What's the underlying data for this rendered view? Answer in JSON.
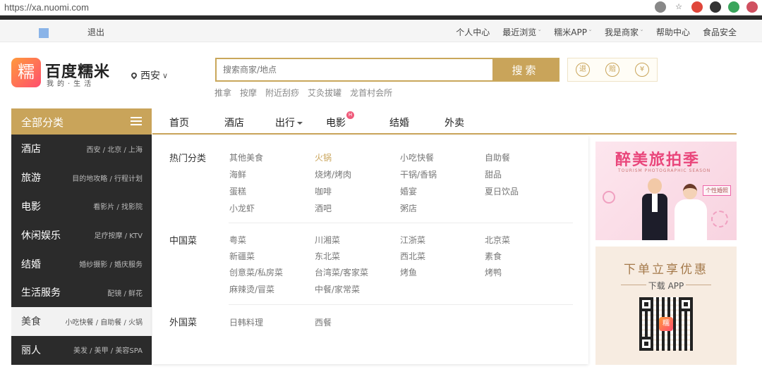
{
  "browser": {
    "url": "https://xa.nuomi.com"
  },
  "topbar": {
    "logout": "退出",
    "links": [
      "个人中心",
      "最近浏览",
      "糯米APP",
      "我是商家",
      "帮助中心",
      "食品安全"
    ]
  },
  "header": {
    "logo_char": "糯",
    "logo_title": "百度糯米",
    "logo_subtitle": "我的·生活",
    "city": "西安",
    "search_placeholder": "搜索商家/地点",
    "search_button": "搜索",
    "hot_words": [
      "推拿",
      "按摩",
      "附近刮痧",
      "艾灸拔罐",
      "龙首村会所"
    ],
    "promises": [
      "退",
      "赔",
      "¥"
    ]
  },
  "sidebar": {
    "title": "全部分类",
    "items": [
      {
        "name": "酒店",
        "sub": "西安 / 北京 / 上海"
      },
      {
        "name": "旅游",
        "sub": "目的地攻略 / 行程计划"
      },
      {
        "name": "电影",
        "sub": "看影片 / 找影院"
      },
      {
        "name": "休闲娱乐",
        "sub": "足疗按摩 / KTV"
      },
      {
        "name": "结婚",
        "sub": "婚纱摄影 / 婚庆服务"
      },
      {
        "name": "生活服务",
        "sub": "配镜 / 鲜花"
      },
      {
        "name": "美食",
        "sub": "小吃快餐 / 自助餐 / 火锅"
      },
      {
        "name": "丽人",
        "sub": "美发 / 美甲 / 美容SPA"
      }
    ]
  },
  "nav": {
    "items": [
      "首页",
      "酒店",
      "出行",
      "电影",
      "结婚",
      "外卖"
    ],
    "badge": "H"
  },
  "panel": {
    "sections": [
      {
        "title": "热门分类",
        "items": [
          "其他美食",
          "火锅",
          "小吃快餐",
          "自助餐",
          "海鲜",
          "烧烤/烤肉",
          "干锅/香锅",
          "甜品",
          "蛋糕",
          "咖啡",
          "婚宴",
          "夏日饮品",
          "小龙虾",
          "酒吧",
          "粥店"
        ]
      },
      {
        "title": "中国菜",
        "items": [
          "粤菜",
          "川湘菜",
          "江浙菜",
          "北京菜",
          "新疆菜",
          "东北菜",
          "西北菜",
          "素食",
          "创意菜/私房菜",
          "台湾菜/客家菜",
          "烤鱼",
          "烤鸭",
          "麻辣烫/冒菜",
          "中餐/家常菜"
        ]
      },
      {
        "title": "外国菜",
        "items": [
          "日韩料理",
          "西餐"
        ]
      }
    ]
  },
  "banners": {
    "wedding_title": "醉美旅拍季",
    "wedding_sub": "TOURISM PHOTOGRAPHIC SEASON",
    "wedding_sign": "个性婚照",
    "app_title": "下单立享优惠",
    "app_sub": "下载 APP",
    "qr_logo": "糯"
  },
  "colors": {
    "accent": "#c9a45a",
    "sidebar_bg": "#2b2b2b",
    "highlight_text": "#c9a45a"
  }
}
